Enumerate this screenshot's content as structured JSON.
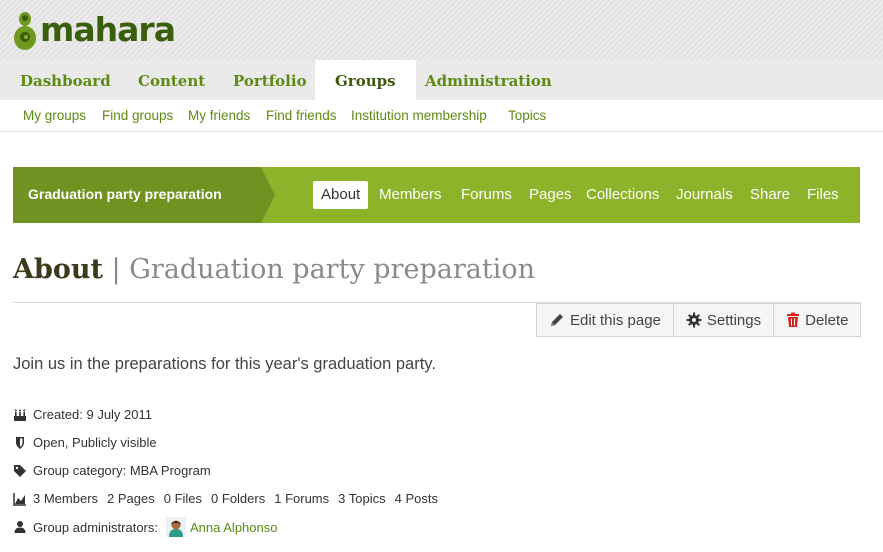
{
  "brand": {
    "name": "mahara"
  },
  "main_nav": {
    "tabs": [
      {
        "label": "Dashboard"
      },
      {
        "label": "Content"
      },
      {
        "label": "Portfolio"
      },
      {
        "label": "Groups",
        "active": true
      },
      {
        "label": "Administration"
      }
    ]
  },
  "sub_nav": {
    "items": [
      {
        "label": "My groups"
      },
      {
        "label": "Find groups"
      },
      {
        "label": "My friends"
      },
      {
        "label": "Find friends"
      },
      {
        "label": "Institution membership"
      },
      {
        "label": "Topics"
      }
    ]
  },
  "group": {
    "title": "Graduation party preparation",
    "tabs": [
      {
        "label": "About",
        "active": true
      },
      {
        "label": "Members"
      },
      {
        "label": "Forums"
      },
      {
        "label": "Pages"
      },
      {
        "label": "Collections"
      },
      {
        "label": "Journals"
      },
      {
        "label": "Share"
      },
      {
        "label": "Files"
      }
    ]
  },
  "page": {
    "heading_main": "About",
    "heading_sep": "|",
    "heading_sub": "Graduation party preparation",
    "description": "Join us in the preparations for this year's graduation party."
  },
  "actions": {
    "edit_label": "Edit this page",
    "settings_label": "Settings",
    "delete_label": "Delete"
  },
  "info": {
    "created": "Created: 9 July 2011",
    "visibility": "Open, Publicly visible",
    "category": "Group category: MBA Program",
    "stats": [
      "3 Members",
      "2 Pages",
      "0 Files",
      "0 Folders",
      "1 Forums",
      "3 Topics",
      "4 Posts"
    ],
    "admins_label": "Group administrators:",
    "admin_name": "Anna Alphonso"
  },
  "colors": {
    "accent": "#5d8a12",
    "group_bar": "#8db32a",
    "group_title_bg": "#6f9220",
    "delete_red": "#d9261c"
  },
  "icons": {
    "edit": "pencil-icon",
    "settings": "gear-icon",
    "delete": "trash-icon",
    "created": "birthday-cake-icon",
    "visibility": "shield-icon",
    "category": "tag-icon",
    "stats": "area-chart-icon",
    "admins": "user-icon"
  }
}
